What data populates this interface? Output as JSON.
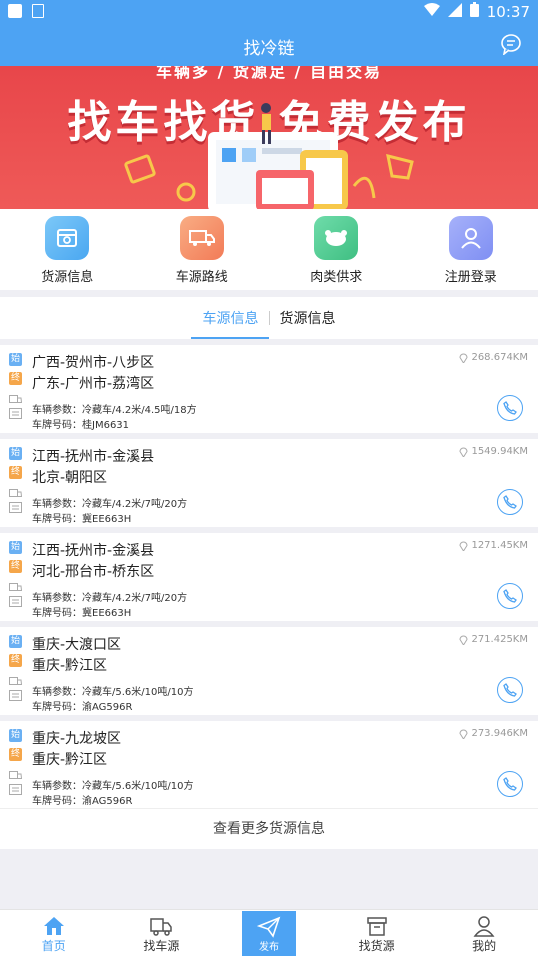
{
  "status_bar": {
    "time": "10:37"
  },
  "header": {
    "title": "找冷链"
  },
  "banner": {
    "subtitle": "车辆多 / 货源足 / 自由交易",
    "headline": "找车找货 免费发布"
  },
  "shortcuts": [
    {
      "label": "货源信息",
      "icon": "cargo-search-icon",
      "color": "#5ab4f5"
    },
    {
      "label": "车源路线",
      "icon": "truck-icon",
      "color": "#f7966b"
    },
    {
      "label": "肉类供求",
      "icon": "chicken-icon",
      "color": "#4fc98e"
    },
    {
      "label": "注册登录",
      "icon": "user-icon",
      "color": "#8f9ef7"
    }
  ],
  "tabs": [
    {
      "label": "车源信息",
      "active": true
    },
    {
      "label": "货源信息",
      "active": false
    }
  ],
  "badges": {
    "start": "始",
    "end": "终"
  },
  "listings": [
    {
      "from": "广西-贺州市-八步区",
      "to": "广东-广州市-荔湾区",
      "distance": "268.674KM",
      "params": "车辆参数：冷藏车/4.2米/4.5吨/18方",
      "plate": "车牌号码：桂JM6631"
    },
    {
      "from": "江西-抚州市-金溪县",
      "to": "北京-朝阳区",
      "distance": "1549.94KM",
      "params": "车辆参数：冷藏车/4.2米/7吨/20方",
      "plate": "车牌号码：冀EE663H"
    },
    {
      "from": "江西-抚州市-金溪县",
      "to": "河北-邢台市-桥东区",
      "distance": "1271.45KM",
      "params": "车辆参数：冷藏车/4.2米/7吨/20方",
      "plate": "车牌号码：冀EE663H"
    },
    {
      "from": "重庆-大渡口区",
      "to": "重庆-黔江区",
      "distance": "271.425KM",
      "params": "车辆参数：冷藏车/5.6米/10吨/10方",
      "plate": "车牌号码：渝AG596R"
    },
    {
      "from": "重庆-九龙坡区",
      "to": "重庆-黔江区",
      "distance": "273.946KM",
      "params": "车辆参数：冷藏车/5.6米/10吨/10方",
      "plate": "车牌号码：渝AG596R"
    }
  ],
  "more_link": "查看更多货源信息",
  "bottom_nav": [
    {
      "label": "首页",
      "icon": "home-icon",
      "active": true
    },
    {
      "label": "找车源",
      "icon": "truck-icon",
      "active": false
    },
    {
      "label": "发布",
      "icon": "send-icon",
      "active": false
    },
    {
      "label": "找货源",
      "icon": "box-icon",
      "active": false
    },
    {
      "label": "我的",
      "icon": "user-icon",
      "active": false
    }
  ],
  "colors": {
    "primary": "#4da3f3",
    "banner": "#e8464a",
    "start_badge": "#6ab0f3",
    "end_badge": "#f5a64a"
  }
}
